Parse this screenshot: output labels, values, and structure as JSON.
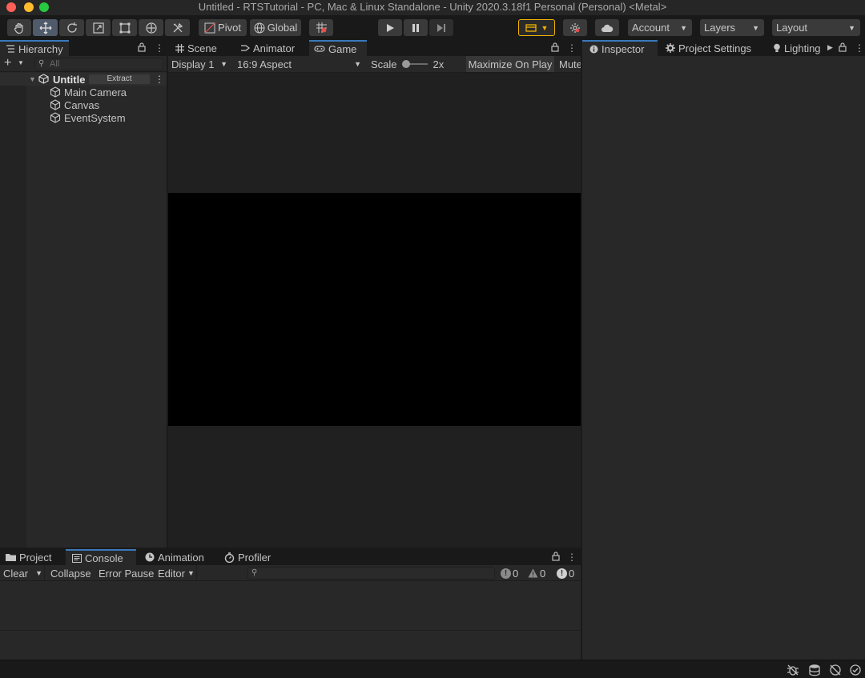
{
  "window": {
    "title": "Untitled - RTSTutorial - PC, Mac & Linux Standalone - Unity 2020.3.18f1 Personal (Personal) <Metal>"
  },
  "toolbar": {
    "tools": [
      "hand-tool-icon",
      "move-tool-icon",
      "rotate-tool-icon",
      "scale-tool-icon",
      "rect-tool-icon",
      "transform-tool-icon",
      "custom-tool-icon"
    ],
    "pivot_label": "Pivot",
    "global_label": "Global",
    "account_label": "Account",
    "layers_label": "Layers",
    "layout_label": "Layout"
  },
  "hierarchy": {
    "tab_label": "Hierarchy",
    "search_placeholder": "All",
    "scene_name": "Untitle",
    "extract_label": "Extract",
    "items": [
      {
        "label": "Main Camera"
      },
      {
        "label": "Canvas"
      },
      {
        "label": "EventSystem"
      }
    ]
  },
  "center_tabs": {
    "scene": "Scene",
    "animator": "Animator",
    "game": "Game"
  },
  "game_toolbar": {
    "display": "Display 1",
    "aspect": "16:9 Aspect",
    "scale_label": "Scale",
    "scale_value": "2x",
    "maximize": "Maximize On Play",
    "mute": "Mute"
  },
  "right_tabs": {
    "inspector": "Inspector",
    "project_settings": "Project Settings",
    "lighting": "Lighting"
  },
  "bottom_tabs": {
    "project": "Project",
    "console": "Console",
    "animation": "Animation",
    "profiler": "Profiler"
  },
  "console": {
    "clear": "Clear",
    "collapse": "Collapse",
    "error_pause": "Error Pause",
    "editor": "Editor",
    "log_count": "0",
    "warning_count": "0",
    "error_count": "0"
  },
  "colors": {
    "accent": "#3a79bb",
    "play_highlight": "#f0b400"
  }
}
